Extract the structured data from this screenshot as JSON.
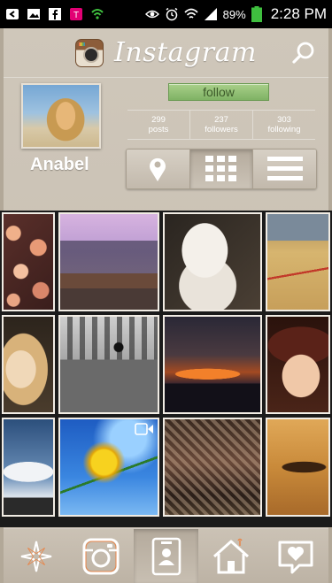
{
  "status_bar": {
    "battery_percent": "89%",
    "time": "2:28 PM"
  },
  "header": {
    "title": "Instagram"
  },
  "profile": {
    "username": "Anabel",
    "follow_label": "follow",
    "stats": [
      {
        "value": "299",
        "label": "posts"
      },
      {
        "value": "237",
        "label": "followers"
      },
      {
        "value": "303",
        "label": "following"
      }
    ]
  },
  "view_toggle": [
    "map-pin-icon",
    "grid-icon",
    "list-icon"
  ],
  "photos": [
    {
      "name": "photo-flowers",
      "colors": [
        "#5a2f2a",
        "#d98a6a"
      ]
    },
    {
      "name": "photo-city-locks",
      "colors": [
        "#c59bd1",
        "#7a5a4a"
      ]
    },
    {
      "name": "photo-white-dog",
      "colors": [
        "#2a2520",
        "#e8e2da"
      ]
    },
    {
      "name": "photo-gym-court",
      "colors": [
        "#8d6a3a",
        "#d7b56f"
      ]
    },
    {
      "name": "photo-blonde-portrait",
      "colors": [
        "#3a2e22",
        "#d3b07a"
      ]
    },
    {
      "name": "photo-spider-skyline",
      "colors": [
        "#9a9a9a",
        "#5a5a5a"
      ]
    },
    {
      "name": "photo-sunset-skyline",
      "colors": [
        "#1c1a2a",
        "#c85a22"
      ]
    },
    {
      "name": "photo-woman-hat",
      "colors": [
        "#3a1a12",
        "#e8b89a"
      ]
    },
    {
      "name": "photo-cloudy-sky",
      "colors": [
        "#3b5a85",
        "#dfe4ea"
      ]
    },
    {
      "name": "photo-dandelion",
      "colors": [
        "#2a6fcf",
        "#f3c21c"
      ]
    },
    {
      "name": "photo-boots",
      "colors": [
        "#3a2a20",
        "#b08a6a"
      ]
    },
    {
      "name": "photo-eye-closeup",
      "colors": [
        "#d09a4a",
        "#8a5a2a"
      ]
    }
  ],
  "bottom_nav": [
    "star-icon",
    "camera-icon",
    "profile-card-icon",
    "home-icon",
    "heart-bubble-icon"
  ],
  "colors": {
    "background": "#c9c0b3",
    "follow_green": "#7fb264",
    "text_white": "#ffffff"
  }
}
